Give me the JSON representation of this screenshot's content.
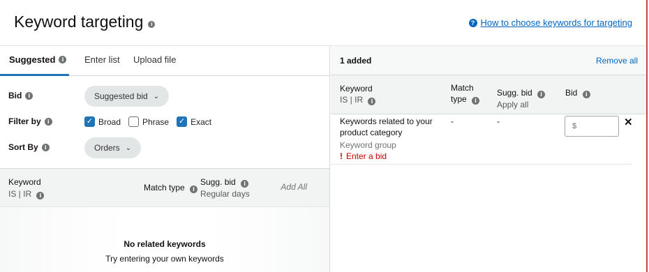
{
  "header": {
    "title": "Keyword targeting",
    "help_link": "How to choose keywords for targeting"
  },
  "left": {
    "tabs": [
      {
        "label": "Suggested",
        "active": true
      },
      {
        "label": "Enter list",
        "active": false
      },
      {
        "label": "Upload file",
        "active": false
      }
    ],
    "bid": {
      "label": "Bid",
      "value": "Suggested bid"
    },
    "filter": {
      "label": "Filter by",
      "options": [
        {
          "label": "Broad",
          "checked": true
        },
        {
          "label": "Phrase",
          "checked": false
        },
        {
          "label": "Exact",
          "checked": true
        }
      ]
    },
    "sort": {
      "label": "Sort By",
      "value": "Orders"
    },
    "table": {
      "col_keyword": "Keyword",
      "col_keyword_sub": "IS | IR",
      "col_match_type": "Match type",
      "col_sugg_bid": "Sugg. bid",
      "col_sugg_bid_sub": "Regular days",
      "add_all": "Add All"
    },
    "empty": {
      "title": "No related keywords",
      "subtitle": "Try entering your own keywords"
    }
  },
  "right": {
    "added_count": "1 added",
    "remove_all": "Remove all",
    "table": {
      "col_keyword": "Keyword",
      "col_keyword_sub": "IS | IR",
      "col_match_line1": "Match",
      "col_match_line2": "type",
      "col_sugg_bid": "Sugg. bid",
      "col_sugg_bid_sub": "Apply all",
      "col_bid": "Bid"
    },
    "rows": [
      {
        "keyword_line1": "Keywords related to your",
        "keyword_line2": "product category",
        "group": "Keyword group",
        "error": "Enter a bid",
        "match_type": "-",
        "sugg_bid": "-",
        "bid_placeholder": "$"
      }
    ]
  },
  "colors": {
    "accent": "#1f74b8",
    "link": "#0066c0",
    "error": "#c40000",
    "frame_border": "#c5453f"
  }
}
